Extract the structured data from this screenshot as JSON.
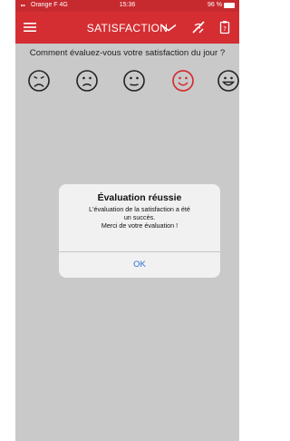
{
  "status_bar": {
    "carrier": "Orange F 4G",
    "time": "15:36",
    "battery": "96 %",
    "battery_level": 0.96
  },
  "header": {
    "title": "SATISFACTION",
    "icons": [
      "menu-icon",
      "chevron-down-icon",
      "signal-off-icon",
      "file-icon"
    ]
  },
  "survey": {
    "question": "Comment évaluez-vous votre satisfaction du jour ?",
    "options": [
      {
        "name": "very-unhappy",
        "selected": false
      },
      {
        "name": "unhappy",
        "selected": false
      },
      {
        "name": "neutral",
        "selected": false
      },
      {
        "name": "happy",
        "selected": true
      },
      {
        "name": "very-happy",
        "selected": false
      }
    ]
  },
  "dialog": {
    "title": "Évaluation réussie",
    "message_line1": "L'évaluation de la satisfaction a été",
    "message_line2": "un succès.",
    "message_line3": "Merci de votre évaluation !",
    "ok_label": "OK"
  },
  "colors": {
    "header": "#d42e33",
    "selected_face": "#d42e33",
    "dialog_button": "#2a6fd6"
  }
}
